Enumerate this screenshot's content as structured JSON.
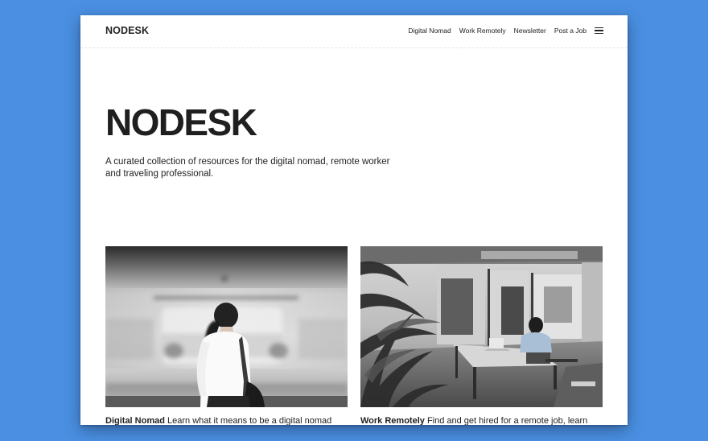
{
  "header": {
    "logo": "NODESK",
    "nav": [
      {
        "label": "Digital Nomad"
      },
      {
        "label": "Work Remotely"
      },
      {
        "label": "Newsletter"
      },
      {
        "label": "Post a Job"
      }
    ],
    "menu_icon": "hamburger-menu-icon"
  },
  "hero": {
    "title": "NODESK",
    "subtitle": "A curated collection of resources for the digital nomad, remote worker and traveling professional."
  },
  "cards": [
    {
      "title": "Digital Nomad",
      "text": "Learn what it means to be a digital nomad",
      "image": "woman-at-subway-train-photo"
    },
    {
      "title": "Work Remotely",
      "text": "Find and get hired for a remote job, learn",
      "image": "coworking-space-photo"
    }
  ],
  "colors": {
    "background": "#4a8fe2",
    "window": "#ffffff",
    "text": "#1e1e1e"
  }
}
